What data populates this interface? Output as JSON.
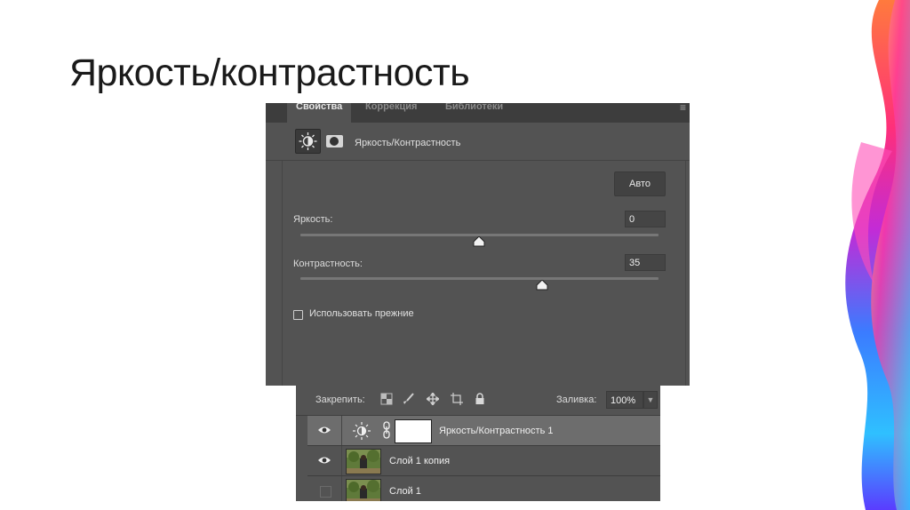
{
  "slide": {
    "title": "Яркость/контрастность"
  },
  "properties_panel": {
    "tabs": [
      {
        "label": "Свойства",
        "active": true
      },
      {
        "label": "Коррекция",
        "active": false
      },
      {
        "label": "Библиотеки",
        "active": false
      }
    ],
    "adjustment_icon": "sun-icon",
    "mask_icon": "layer-mask-icon",
    "header_label": "Яркость/Контрастность",
    "auto_button": "Авто",
    "brightness": {
      "label": "Яркость:",
      "value": "0"
    },
    "contrast": {
      "label": "Контрастность:",
      "value": "35"
    },
    "use_legacy": {
      "label": "Использовать прежние",
      "checked": false
    }
  },
  "layers_panel": {
    "lock_label": "Закрепить:",
    "lock_icons": [
      "lock-transparent-icon",
      "lock-brush-icon",
      "lock-position-icon",
      "lock-artboard-icon",
      "lock-all-icon"
    ],
    "fill_label": "Заливка:",
    "fill_value": "100%",
    "layers": [
      {
        "name": "Яркость/Контрастность 1",
        "visible": true,
        "selected": true,
        "type": "adjustment"
      },
      {
        "name": "Слой 1 копия",
        "visible": true,
        "selected": false,
        "type": "image"
      },
      {
        "name": "Слой 1",
        "visible": false,
        "selected": false,
        "type": "image"
      }
    ]
  },
  "colors": {
    "panel_bg": "#535353",
    "panel_text": "#dcdcdc",
    "selected_row": "#6d6d6d"
  }
}
